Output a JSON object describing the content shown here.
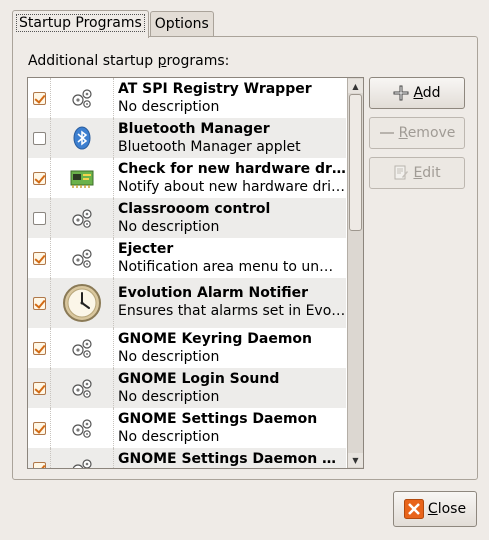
{
  "tabs": [
    {
      "label": "Startup Programs",
      "active": true
    },
    {
      "label": "Options",
      "active": false
    }
  ],
  "section_label_prefix": "Additional startup ",
  "section_label_mnemonic": "p",
  "section_label_suffix": "rograms:",
  "programs": [
    {
      "name": "AT SPI Registry Wrapper",
      "description": "No description",
      "enabled": true,
      "icon": "gear-icon"
    },
    {
      "name": "Bluetooth Manager",
      "description": "Bluetooth Manager applet",
      "enabled": false,
      "icon": "bluetooth-icon"
    },
    {
      "name": "Check for new hardware drivers",
      "description": "Notify about new hardware drivers",
      "enabled": true,
      "icon": "hardware-card-icon"
    },
    {
      "name": "Classrooom control",
      "description": "No description",
      "enabled": false,
      "icon": "gear-icon"
    },
    {
      "name": "Ejecter",
      "description": "Notification area menu to unmount",
      "enabled": true,
      "icon": "gear-icon"
    },
    {
      "name": "Evolution Alarm Notifier",
      "description": "Ensures that alarms set in Evolution",
      "enabled": true,
      "icon": "clock-icon"
    },
    {
      "name": "GNOME Keyring Daemon",
      "description": "No description",
      "enabled": true,
      "icon": "gear-icon"
    },
    {
      "name": "GNOME Login Sound",
      "description": "No description",
      "enabled": true,
      "icon": "gear-icon"
    },
    {
      "name": "GNOME Settings Daemon",
      "description": "No description",
      "enabled": true,
      "icon": "gear-icon"
    },
    {
      "name": "GNOME Settings Daemon Helper",
      "description": "",
      "enabled": true,
      "icon": "gear-icon"
    }
  ],
  "buttons": {
    "add_mnemonic": "A",
    "add_rest": "dd",
    "remove_mnemonic": "R",
    "remove_rest": "emove",
    "edit_mnemonic": "E",
    "edit_rest": "dit",
    "close_mnemonic": "C",
    "close_rest": "lose"
  },
  "colors": {
    "check_accent": "#d36b15",
    "close_icon": "#e8641b"
  }
}
